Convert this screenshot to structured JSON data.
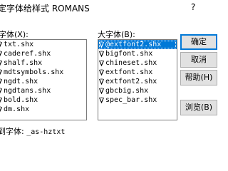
{
  "window": {
    "title": "定字体给样式 ROMANS",
    "help_icon": "?"
  },
  "small_font": {
    "label": "字体(X):",
    "items": [
      "txt.shx",
      "caderef.shx",
      "shalf.shx",
      "mdtsymbols.shx",
      "ngdt.shx",
      "ngdtans.shx",
      "bold.shx",
      "dm.shx"
    ]
  },
  "big_font": {
    "label": "大字体(B):",
    "items": [
      "@extfont2.shx",
      "bigfont.shx",
      "chineset.shx",
      "extfont.shx",
      "extfont2.shx",
      "gbcbig.shx",
      "spec_bar.shx"
    ],
    "selected_index": 0
  },
  "buttons": {
    "ok": "确定",
    "cancel": "取消",
    "help": "帮助(H)",
    "browse": "浏览(B)"
  },
  "status": {
    "label": "到字体:",
    "value": "_as-hztxt"
  },
  "colors": {
    "selection": "#0078d7",
    "default_button_border": "#0078d7"
  }
}
